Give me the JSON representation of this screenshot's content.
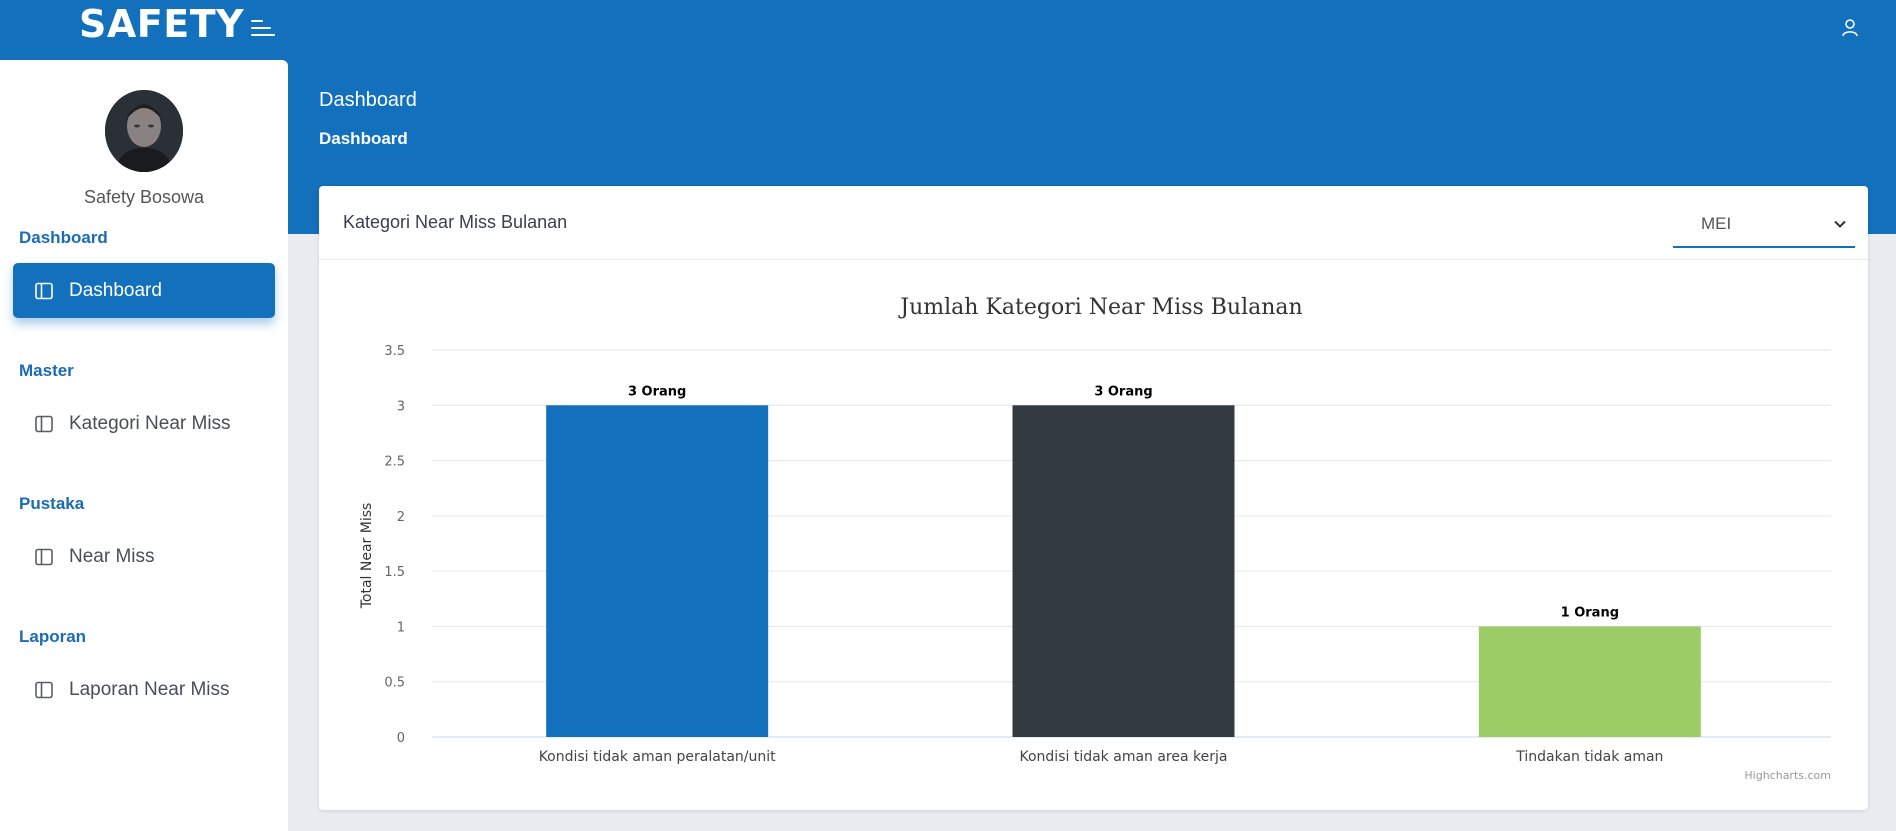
{
  "app": {
    "brand": "SAFETY"
  },
  "profile": {
    "name": "Safety Bosowa"
  },
  "sidebar": {
    "sections": [
      {
        "heading": "Dashboard",
        "item": "Dashboard"
      },
      {
        "heading": "Master",
        "item": "Kategori Near Miss"
      },
      {
        "heading": "Pustaka",
        "item": "Near Miss"
      },
      {
        "heading": "Laporan",
        "item": "Laporan Near Miss"
      }
    ]
  },
  "header": {
    "title": "Dashboard",
    "breadcrumb": "Dashboard"
  },
  "card": {
    "title": "Kategori Near Miss Bulanan",
    "month_select": {
      "value": "MEI"
    }
  },
  "chart_data": {
    "type": "bar",
    "title": "Jumlah Kategori Near Miss Bulanan",
    "ylabel": "Total Near Miss",
    "categories": [
      "Kondisi tidak aman peralatan/unit",
      "Kondisi tidak aman area kerja",
      "Tindakan tidak aman"
    ],
    "values": [
      3,
      3,
      1
    ],
    "data_labels": [
      "3 Orang",
      "3 Orang",
      "1 Orang"
    ],
    "colors": [
      "#1270bc",
      "#343a42",
      "#9ccc65"
    ],
    "ylim": [
      0,
      3.5
    ],
    "yticks": [
      "0",
      "0.5",
      "1",
      "1.5",
      "2",
      "2.5",
      "3",
      "3.5"
    ],
    "grid": true,
    "credits": "Highcharts.com"
  },
  "colors": {
    "primary": "#1270bc"
  }
}
